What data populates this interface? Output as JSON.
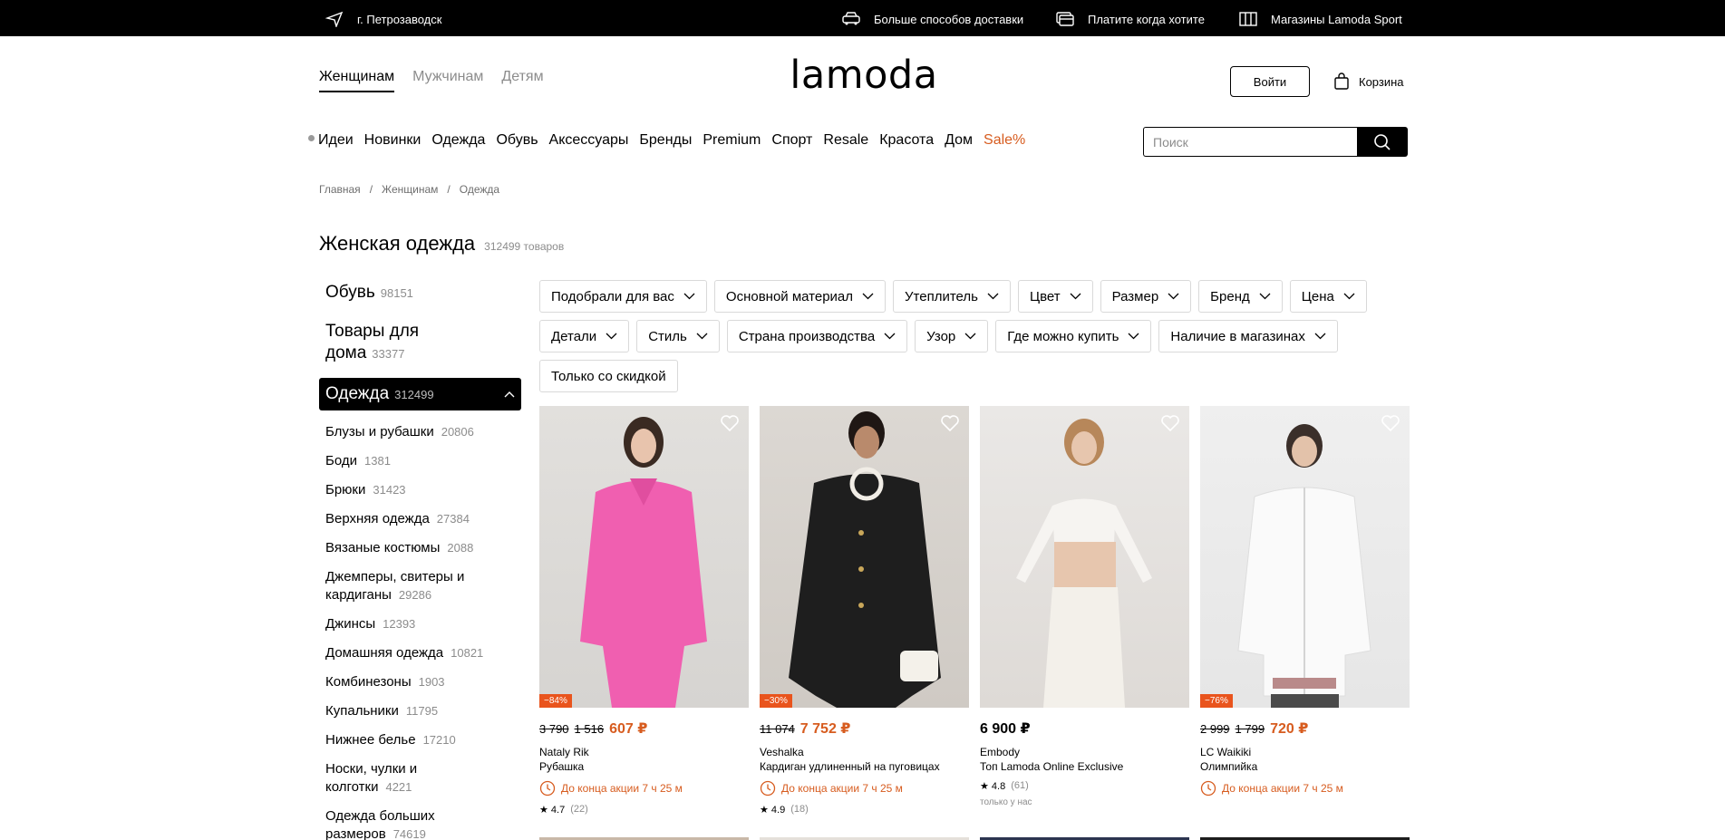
{
  "topbar": {
    "city": "г. Петрозаводск",
    "delivery": "Больше способов доставки",
    "pay": "Платите когда хотите",
    "stores": "Магазины Lamoda Sport"
  },
  "header": {
    "genders": [
      "Женщинам",
      "Мужчинам",
      "Детям"
    ],
    "logo": "lamoda",
    "login": "Войти",
    "cart": "Корзина"
  },
  "nav": {
    "items": [
      "Идеи",
      "Новинки",
      "Одежда",
      "Обувь",
      "Аксессуары",
      "Бренды",
      "Premium",
      "Спорт",
      "Resale",
      "Красота",
      "Дом"
    ],
    "sale": "Sale%",
    "search_placeholder": "Поиск"
  },
  "breadcrumb": [
    "Главная",
    "/",
    "Женщинам",
    "/",
    "Одежда"
  ],
  "title": {
    "text": "Женская одежда",
    "count": "312499 товаров"
  },
  "sidebar": {
    "top": [
      {
        "label": "Обувь",
        "count": "98151"
      },
      {
        "label": "Товары для дома",
        "count": "33377"
      }
    ],
    "active": {
      "label": "Одежда",
      "count": "312499"
    },
    "sub": [
      {
        "label": "Блузы и рубашки",
        "count": "20806"
      },
      {
        "label": "Боди",
        "count": "1381"
      },
      {
        "label": "Брюки",
        "count": "31423"
      },
      {
        "label": "Верхняя одежда",
        "count": "27384"
      },
      {
        "label": "Вязаные костюмы",
        "count": "2088"
      },
      {
        "label": "Джемперы, свитеры и кардиганы",
        "count": "29286"
      },
      {
        "label": "Джинсы",
        "count": "12393"
      },
      {
        "label": "Домашняя одежда",
        "count": "10821"
      },
      {
        "label": "Комбинезоны",
        "count": "1903"
      },
      {
        "label": "Купальники",
        "count": "11795"
      },
      {
        "label": "Нижнее белье",
        "count": "17210"
      },
      {
        "label": "Носки, чулки и колготки",
        "count": "4221"
      },
      {
        "label": "Одежда больших размеров",
        "count": "74619"
      }
    ]
  },
  "filters": [
    "Подобрали для вас",
    "Основной материал",
    "Утеплитель",
    "Цвет",
    "Размер",
    "Бренд",
    "Цена",
    "Детали",
    "Стиль",
    "Страна производства",
    "Узор",
    "Где можно купить",
    "Наличие в магазинах",
    "Только со скидкой"
  ],
  "products": [
    {
      "badge": "−84%",
      "old1": "3 790",
      "old2": "1 516",
      "price": "607 ₽",
      "brand": "Nataly Rik",
      "name": "Рубашка",
      "timer": "До конца акции 7 ч 25 м",
      "rating": "★ 4.7",
      "reviews": "(22)",
      "bg": "#f05fb0"
    },
    {
      "badge": "−30%",
      "old1": "11 074",
      "old2": "",
      "price": "7 752 ₽",
      "brand": "Veshalka",
      "name": "Кардиган удлиненный на пуговицах",
      "timer": "До конца акции 7 ч 25 м",
      "rating": "★ 4.9",
      "reviews": "(18)",
      "bg": "#1e1e1e"
    },
    {
      "badge": "",
      "old1": "",
      "old2": "",
      "price": "6 900 ₽",
      "brand": "Embody",
      "name": "Топ Lamoda Online Exclusive",
      "timer": "",
      "rating": "★ 4.8",
      "reviews": "(61)",
      "only": "только у нас",
      "bg": "#e6e3df"
    },
    {
      "badge": "−76%",
      "old1": "2 999",
      "old2": "1 799",
      "price": "720 ₽",
      "brand": "LC Waikiki",
      "name": "Олимпийка",
      "timer": "До конца акции 7 ч 25 м",
      "rating": "",
      "reviews": "",
      "bg": "#eeeeee"
    }
  ]
}
